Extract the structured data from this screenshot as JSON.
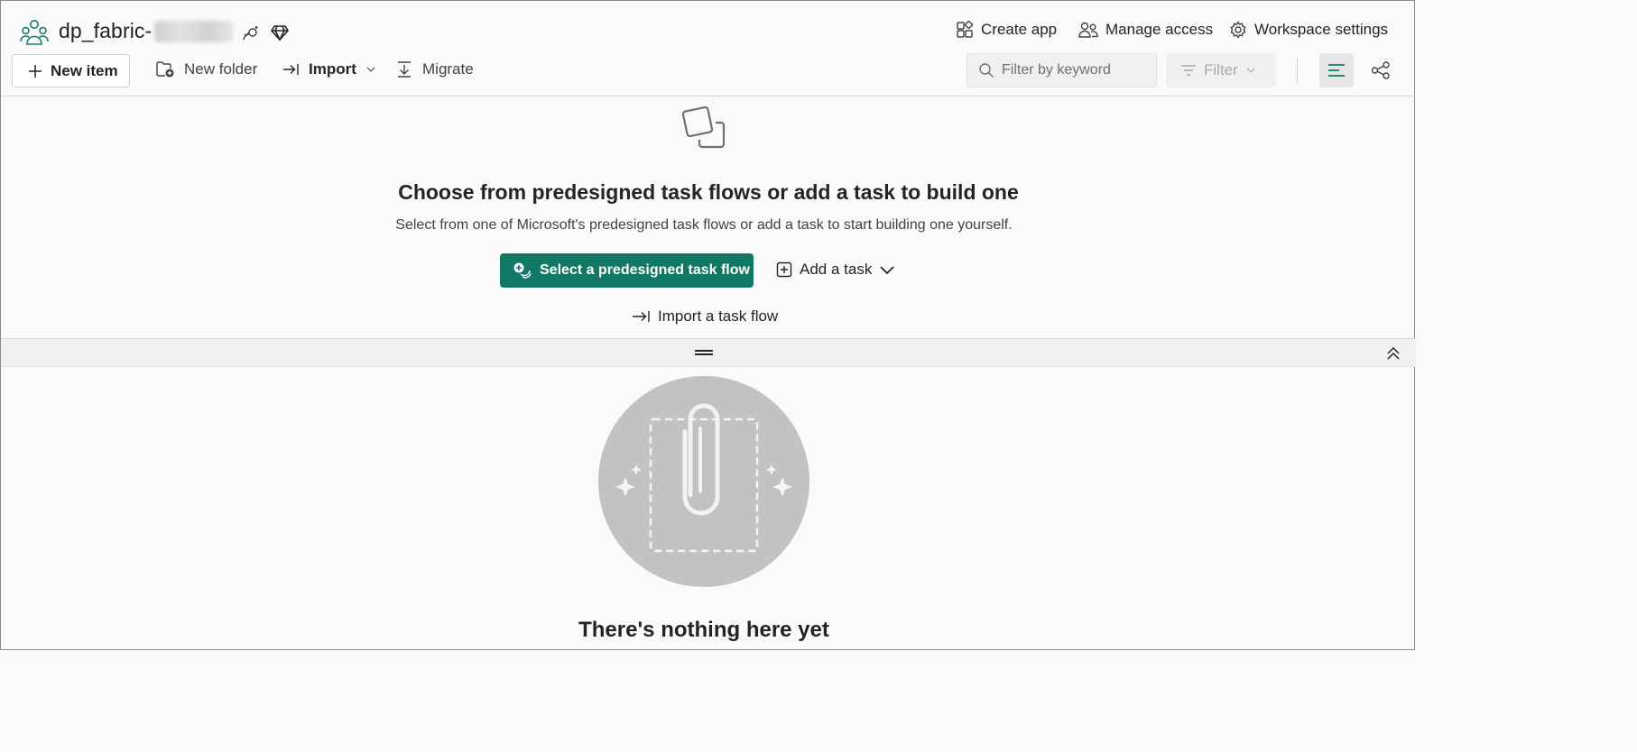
{
  "workspace": {
    "name": "dp_fabric-",
    "icons": [
      "workspace-people-icon",
      "task-flow-sparkle-icon",
      "premium-diamond-icon"
    ]
  },
  "header_actions": {
    "create_app": "Create app",
    "manage_access": "Manage access",
    "workspace_settings": "Workspace settings"
  },
  "toolbar": {
    "new_item": "New item",
    "new_folder": "New folder",
    "import": "Import",
    "migrate": "Migrate",
    "search_placeholder": "Filter by keyword",
    "filter": "Filter"
  },
  "task_flow": {
    "title": "Choose from predesigned task flows or add a task to build one",
    "subtitle": "Select from one of Microsoft's predesigned task flows or add a task to start building one yourself.",
    "primary_button": "Select a predesigned task flow",
    "add_task": "Add a task",
    "import_flow": "Import a task flow"
  },
  "empty_state": {
    "title": "There's nothing here yet"
  },
  "colors": {
    "accent": "#117865",
    "workspace_icon": "#1a7f6e",
    "empty_circle": "#c2c2c2"
  }
}
